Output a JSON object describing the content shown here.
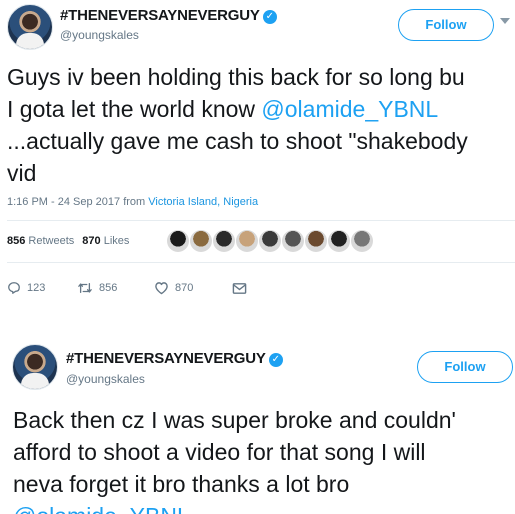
{
  "tweets": [
    {
      "display_name": "#THENEVERSAYNEVERGUY",
      "handle": "@youngskales",
      "follow_label": "Follow",
      "lines": [
        {
          "pre": "Guys iv been holding this back for so long bu",
          "mention": "",
          "post": ""
        },
        {
          "pre": "I gota let the world know ",
          "mention": "@olamide_YBNL",
          "post": ""
        },
        {
          "pre": "...actually gave me cash to shoot \"shakebody",
          "mention": "",
          "post": ""
        },
        {
          "pre": "vid",
          "mention": "",
          "post": ""
        }
      ],
      "time": "1:16 PM - 24 Sep 2017 from ",
      "location": "Victoria Island, Nigeria",
      "retweets_count": "856",
      "retweets_label": "Retweets",
      "likes_count": "870",
      "likes_label": "Likes",
      "liker_colors": [
        "#1a1a1a",
        "#8a6a3f",
        "#2a2a2a",
        "#c7a27a",
        "#3a3a3a",
        "#555555",
        "#6b4a2f",
        "#222222",
        "#777777"
      ],
      "reply_count": "123",
      "retweet_action_count": "856",
      "like_action_count": "870"
    },
    {
      "display_name": "#THENEVERSAYNEVERGUY",
      "handle": "@youngskales",
      "follow_label": "Follow",
      "lines": [
        {
          "pre": "Back then cz I was super broke and couldn'",
          "mention": "",
          "post": ""
        },
        {
          "pre": "afford to shoot a video for that song I will",
          "mention": "",
          "post": ""
        },
        {
          "pre": "neva forget it bro thanks a lot bro",
          "mention": "",
          "post": ""
        },
        {
          "pre": "",
          "mention": "@olamide_YBNL",
          "post": ""
        }
      ]
    }
  ],
  "colors": {
    "accent": "#1da1f2",
    "text": "#14171a",
    "muted": "#657786"
  }
}
